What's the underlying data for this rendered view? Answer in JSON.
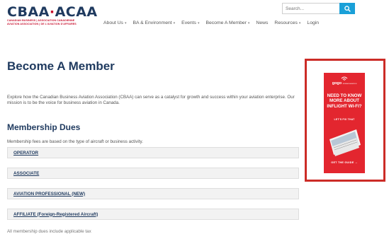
{
  "brand": {
    "name_left": "CBAA",
    "separator": "·",
    "name_right": "ACAA",
    "sub_line1": "CANADIAN BUSINESS | ASSOCIATION CANADIENNE",
    "sub_line2": "AVIATION ASSOCIATION | DE L'AVIATION D'AFFAIRES",
    "primary_color": "#1f3a5f",
    "accent_color": "#c8102e"
  },
  "search": {
    "placeholder": "Search...",
    "button_icon": "search-icon",
    "button_color": "#1aa0d8"
  },
  "nav": {
    "about": "About Us",
    "ba_env": "BA & Environment",
    "events": "Events",
    "become": "Become A Member",
    "news": "News",
    "resources": "Resources",
    "login": "Login",
    "caret": "▾"
  },
  "page": {
    "title": "Become A Member",
    "intro": "Explore how the Canadian Business Aviation Association (CBAA) can serve as a catalyst for growth and success within your aviation enterprise. Our mission is to be the voice for business aviation in Canada.",
    "dues_title": "Membership Dues",
    "dues_desc": "Membership fees are based on the type of aircraft or business activity."
  },
  "accordion": {
    "operator": "OPERATOR",
    "associate": "ASSOCIATE",
    "aviation_professional": "AVIATION PROFESSIONAL (NEW)",
    "affiliate": "AFFILIATE (Foreign-Registered Aircraft)"
  },
  "footnote": "All membership dues include applicable tax",
  "ad": {
    "logo": "gogo",
    "logo_tag": "BUSINESS AVIATION",
    "line1": "NEED TO KNOW",
    "line2": "MORE ABOUT",
    "line3": "INFLIGHT WI-FI?",
    "sub": "LET'S FIX THAT",
    "cta": "GET THE GUIDE",
    "cta_arrow": "→",
    "background": "#e3262f",
    "frame_color": "#cc2c27"
  }
}
